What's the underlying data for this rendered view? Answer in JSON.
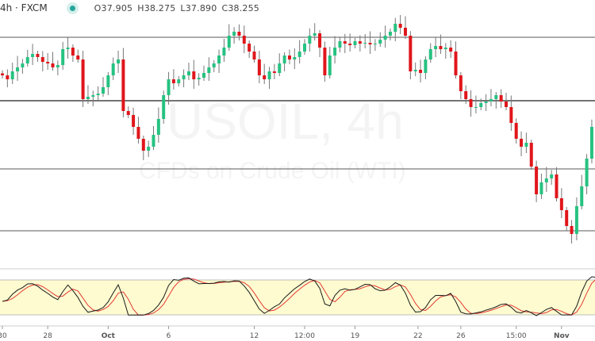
{
  "header": {
    "symbol": "4h · FXCM",
    "open": "O37.905",
    "high": "H38.275",
    "low": "L37.890",
    "close": "C38.255"
  },
  "watermark": {
    "line1": "USOIL, 4h",
    "line2": "CFDs on Crude Oil (WTI)"
  },
  "colors": {
    "up": "#26c281",
    "down": "#e0161b",
    "k": "#1a1a1a",
    "d": "#e53935",
    "band": "#fdfbcf"
  },
  "chart_data": {
    "type": "candlestick",
    "title": "USOIL, 4h",
    "price_range": [
      33.2,
      40.0
    ],
    "closes": [
      38.1,
      38.0,
      38.2,
      38.3,
      38.4,
      38.56,
      38.64,
      38.56,
      38.44,
      38.4,
      38.3,
      38.36,
      38.76,
      38.8,
      38.6,
      38.5,
      37.5,
      37.56,
      37.6,
      37.64,
      37.8,
      38.1,
      38.4,
      38.5,
      37.2,
      37.1,
      36.8,
      36.5,
      36.2,
      36.3,
      36.6,
      37.0,
      37.6,
      38.0,
      37.9,
      38.0,
      38.1,
      38.2,
      38.0,
      38.04,
      38.16,
      38.3,
      38.4,
      38.6,
      38.8,
      39.1,
      39.2,
      39.1,
      38.9,
      38.7,
      38.5,
      38.1,
      38.0,
      38.2,
      38.16,
      38.4,
      38.6,
      38.5,
      38.56,
      38.7,
      38.9,
      39.1,
      39.16,
      38.8,
      38.1,
      38.6,
      38.8,
      38.96,
      38.9,
      38.86,
      38.96,
      38.9,
      38.92,
      38.88,
      38.9,
      39.0,
      39.1,
      39.2,
      39.4,
      39.3,
      39.1,
      38.2,
      38.24,
      38.16,
      38.5,
      38.76,
      38.84,
      38.76,
      38.8,
      38.7,
      38.1,
      37.7,
      37.5,
      37.3,
      37.3,
      37.4,
      37.44,
      37.5,
      37.6,
      37.44,
      37.3,
      36.9,
      36.5,
      36.3,
      36.4,
      35.8,
      35.1,
      35.4,
      35.5,
      35.6,
      35.0,
      34.7,
      34.3,
      34.1,
      34.8,
      35.3,
      36.0,
      36.8,
      37.0
    ],
    "horizontal_levels": [
      39.06,
      37.46,
      35.74,
      34.18
    ],
    "oscillator": {
      "name": "Stochastic",
      "band": [
        20,
        80
      ],
      "range": [
        0,
        100
      ]
    },
    "x_ticks": [
      {
        "label": "30",
        "index": 0
      },
      {
        "label": "28",
        "index": 9
      },
      {
        "label": "Oct",
        "index": 21
      },
      {
        "label": "6",
        "index": 33
      },
      {
        "label": "12",
        "index": 50
      },
      {
        "label": "12:00",
        "index": 60
      },
      {
        "label": "19",
        "index": 70
      },
      {
        "label": "22",
        "index": 82.5
      },
      {
        "label": "26",
        "index": 91
      },
      {
        "label": "15:00",
        "index": 102
      },
      {
        "label": "Nov",
        "index": 111
      }
    ]
  }
}
